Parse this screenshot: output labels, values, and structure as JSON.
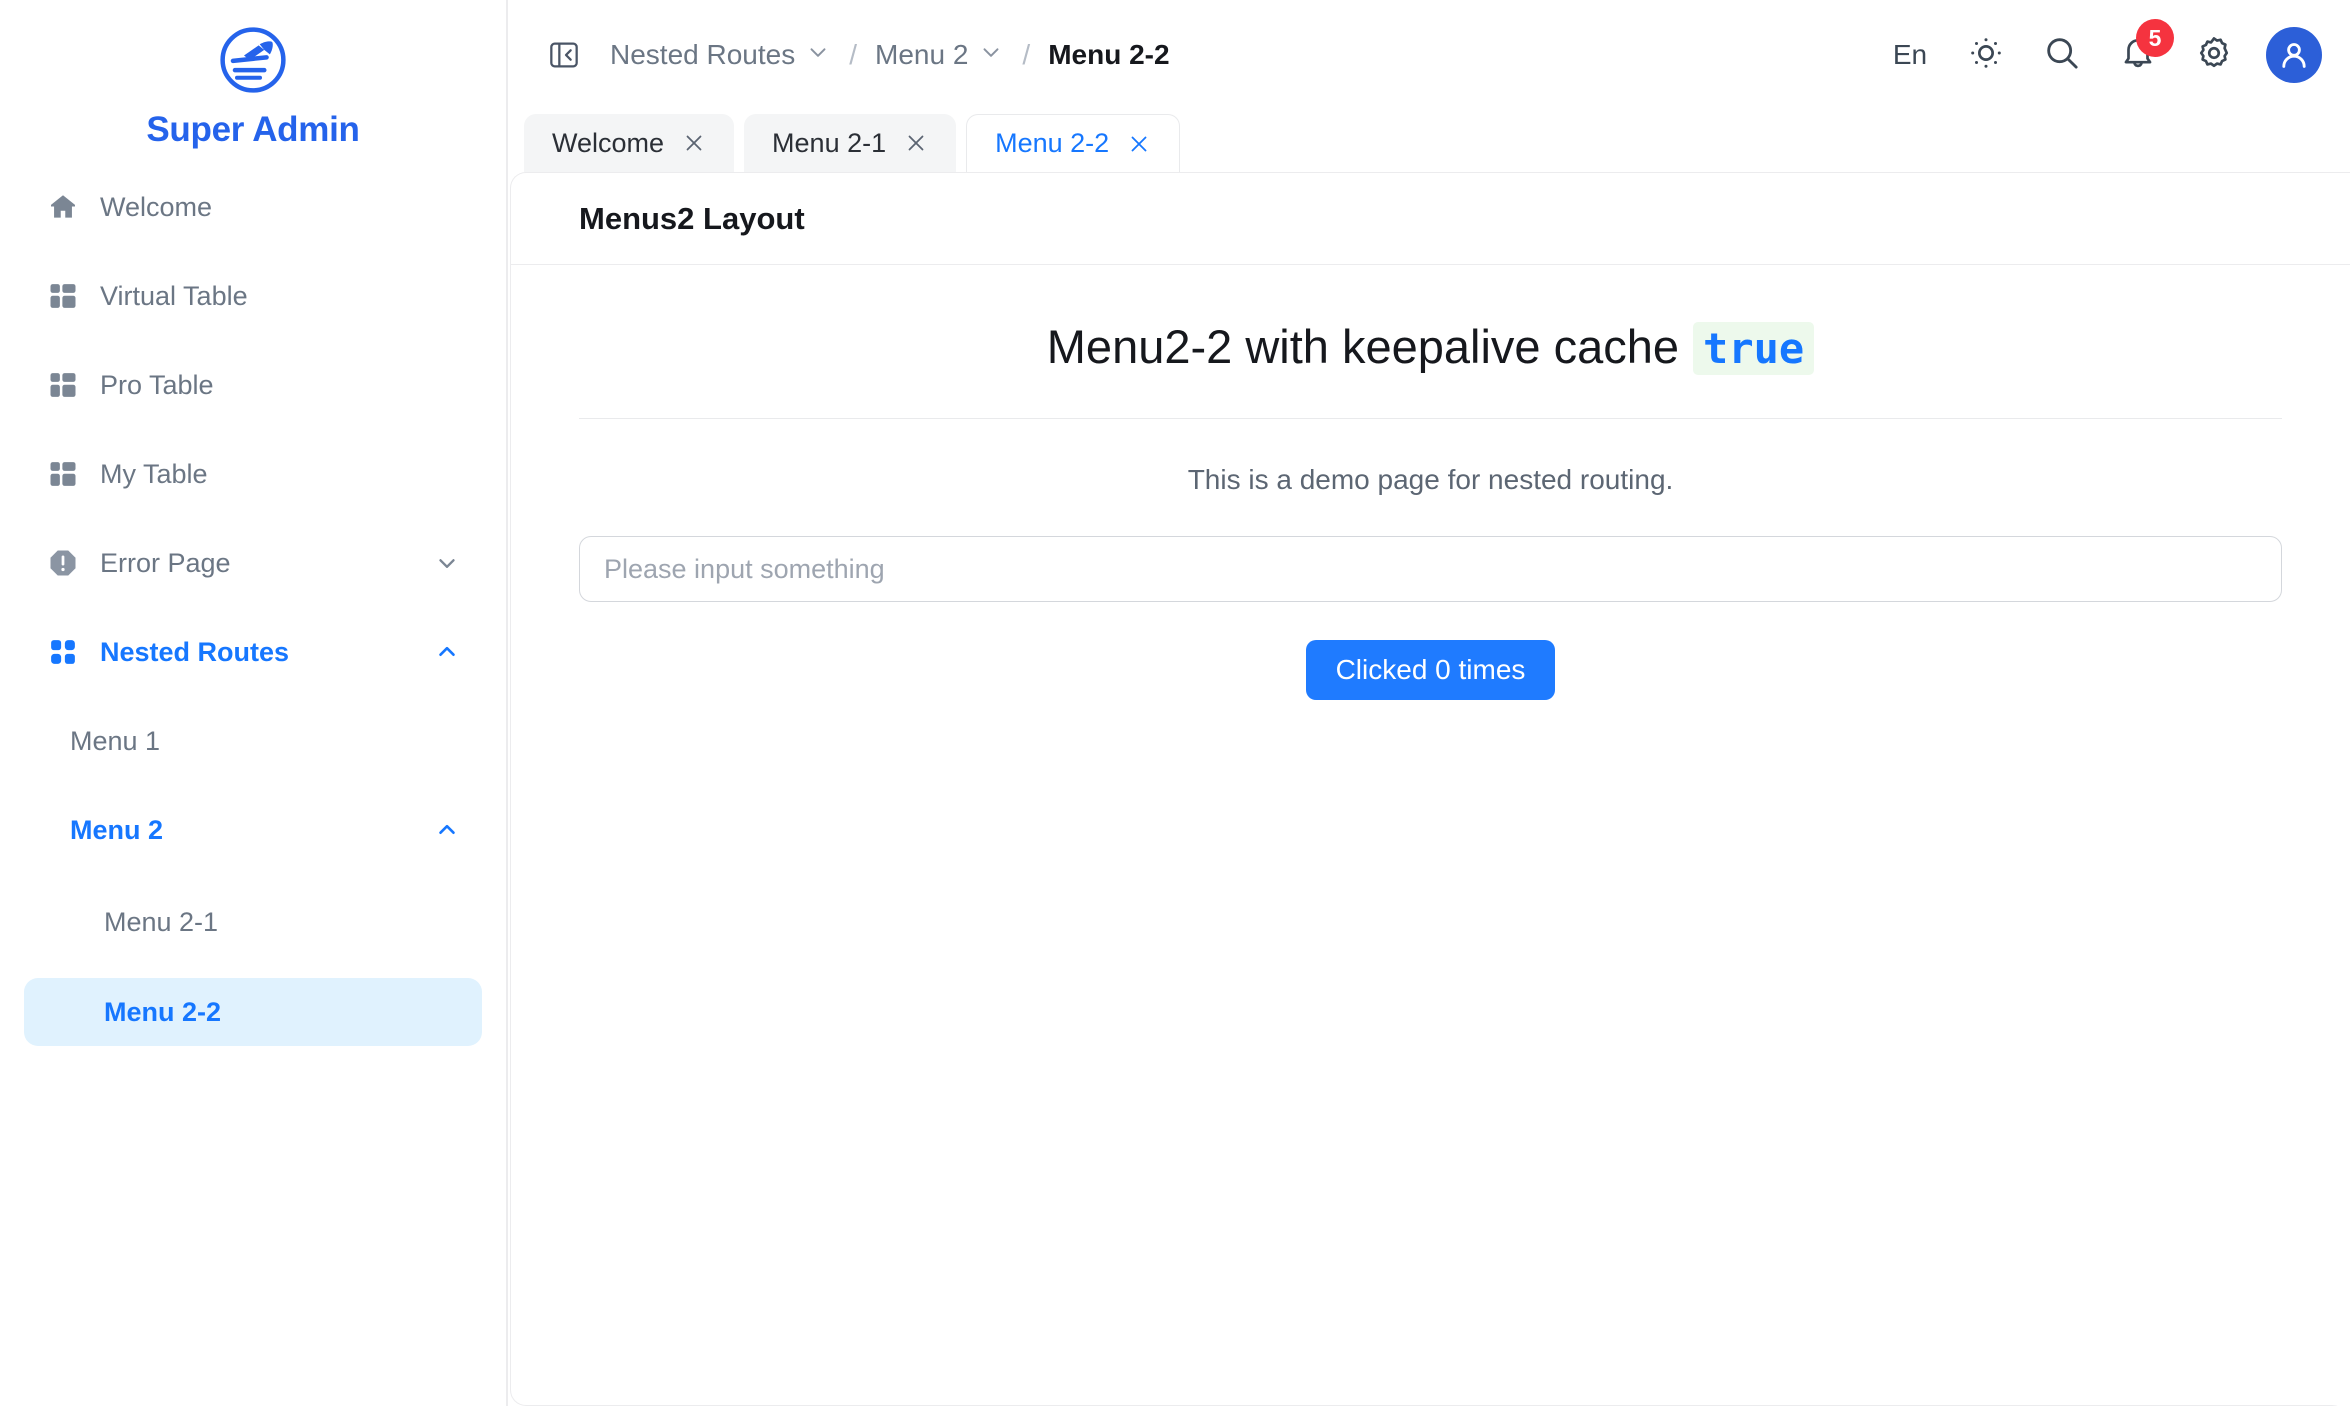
{
  "brand": {
    "name": "Super Admin",
    "logo_icon": "rocket-circle-logo"
  },
  "sidebar": {
    "items": [
      {
        "label": "Welcome",
        "icon": "home-icon"
      },
      {
        "label": "Virtual Table",
        "icon": "table-grid-icon"
      },
      {
        "label": "Pro Table",
        "icon": "table-grid-icon"
      },
      {
        "label": "My Table",
        "icon": "table-grid-icon"
      },
      {
        "label": "Error Page",
        "icon": "alert-octagon-icon",
        "arrow": "chevron-down-icon"
      },
      {
        "label": "Nested Routes",
        "icon": "four-dots-icon",
        "arrow": "chevron-up-icon",
        "active": true
      }
    ],
    "sub_items": [
      {
        "label": "Menu 1"
      },
      {
        "label": "Menu 2",
        "arrow": "chevron-up-icon",
        "open": true
      }
    ],
    "leaf_items": [
      {
        "label": "Menu 2-1",
        "selected": false
      },
      {
        "label": "Menu 2-2",
        "selected": true
      }
    ]
  },
  "header": {
    "collapse_icon": "sidebar-collapse-icon",
    "breadcrumb": [
      {
        "label": "Nested Routes",
        "caret": "chevron-down-icon"
      },
      {
        "label": "Menu 2",
        "caret": "chevron-down-icon"
      },
      {
        "label": "Menu 2-2",
        "caret": ""
      }
    ],
    "separator": "/",
    "actions": {
      "language": "En",
      "theme_icon": "sun-icon",
      "search_icon": "search-icon",
      "bell_icon": "bell-icon",
      "bell_badge": "5",
      "settings_icon": "gear-icon",
      "avatar_icon": "user-avatar-icon"
    }
  },
  "tabs": [
    {
      "label": "Welcome",
      "active": false,
      "close_icon": "close-icon"
    },
    {
      "label": "Menu 2-1",
      "active": false,
      "close_icon": "close-icon"
    },
    {
      "label": "Menu 2-2",
      "active": true,
      "close_icon": "close-icon"
    }
  ],
  "content": {
    "card_title": "Menus2 Layout",
    "demo_title": "Menu2-2 with keepalive cache",
    "demo_code": "true",
    "demo_subtitle": "This is a demo page for nested routing.",
    "input_placeholder": "Please input something",
    "input_value": "",
    "button_label": "Clicked 0 times"
  },
  "colors": {
    "accent": "#1677ff",
    "accent_button": "#1f7bff",
    "badge_red": "#f5333f",
    "avatar_blue": "#2c5fd8",
    "muted_text": "#6b7684",
    "selected_bg": "#e0f2fe",
    "code_bg": "#edf9ec"
  }
}
